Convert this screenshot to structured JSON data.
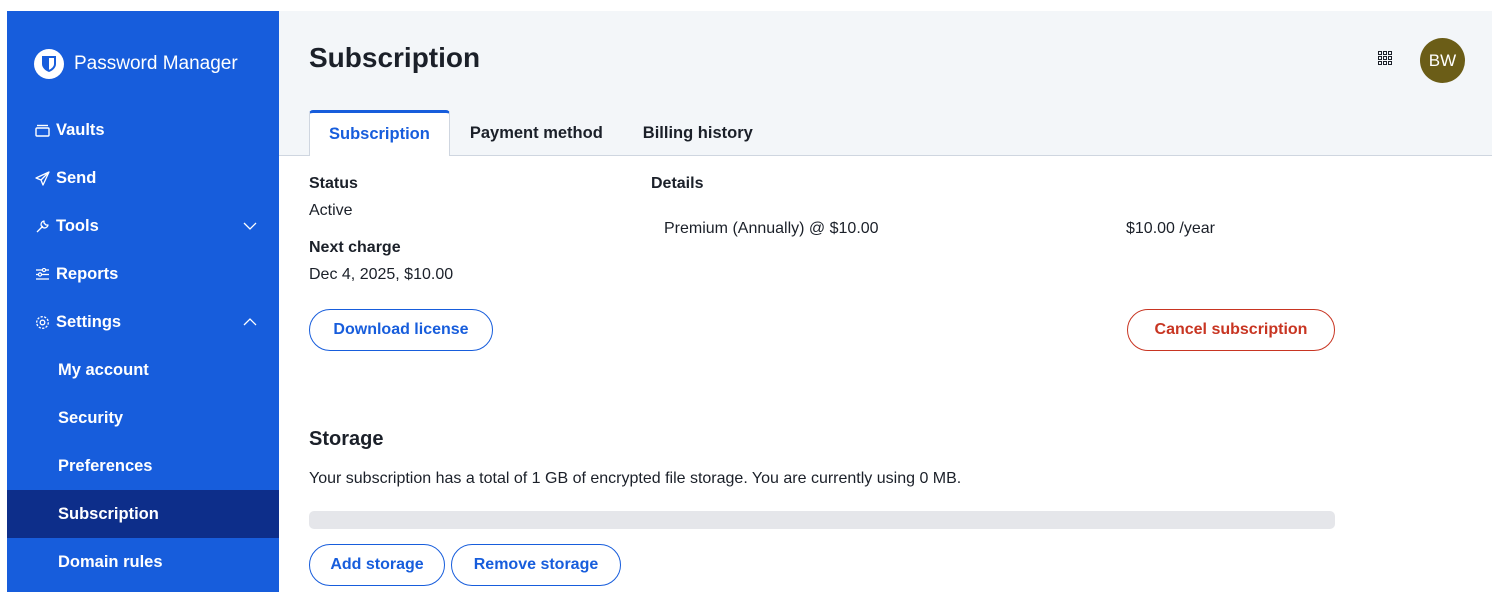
{
  "sidebar": {
    "brand": "Password Manager",
    "items": [
      {
        "label": "Vaults",
        "icon": "vault-icon"
      },
      {
        "label": "Send",
        "icon": "send-icon"
      },
      {
        "label": "Tools",
        "icon": "tools-icon"
      },
      {
        "label": "Reports",
        "icon": "reports-icon"
      },
      {
        "label": "Settings",
        "icon": "gear-icon"
      }
    ],
    "settings_items": [
      "My account",
      "Security",
      "Preferences",
      "Subscription",
      "Domain rules"
    ],
    "active": "Subscription"
  },
  "header": {
    "title": "Subscription",
    "avatar_initials": "BW"
  },
  "tabs": [
    "Subscription",
    "Payment method",
    "Billing history"
  ],
  "subscription": {
    "status_label": "Status",
    "status_value": "Active",
    "next_charge_label": "Next charge",
    "next_charge_value": "Dec 4, 2025, $10.00",
    "details_label": "Details",
    "plan": "Premium (Annually) @ $10.00",
    "price": "$10.00 /year",
    "download_license": "Download license",
    "cancel_subscription": "Cancel subscription"
  },
  "storage": {
    "title": "Storage",
    "text": "Your subscription has a total of 1 GB of encrypted file storage. You are currently using 0 MB.",
    "used_fraction": 0,
    "add": "Add storage",
    "remove": "Remove storage"
  },
  "colors": {
    "brand": "#175ddc",
    "sidebar_active": "#0d2e8a",
    "danger": "#c83522",
    "avatar": "#6b5d17"
  }
}
